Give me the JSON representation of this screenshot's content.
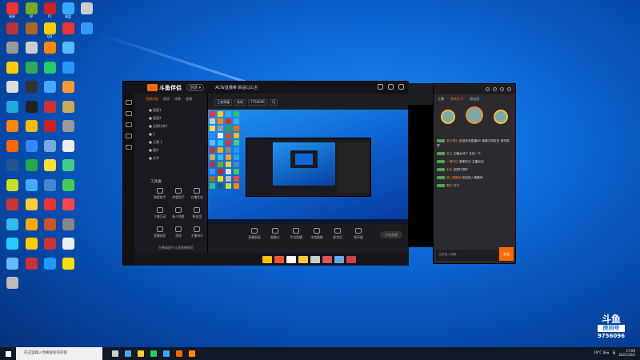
{
  "desktop": {
    "icons": [
      {
        "label": "网易",
        "color": "#e33"
      },
      {
        "label": "W",
        "color": "#7a2"
      },
      {
        "label": "F5",
        "color": "#c22"
      },
      {
        "label": "网盘",
        "color": "#3af"
      },
      {
        "label": "",
        "color": "#ccc"
      },
      {
        "label": "",
        "color": "#b33"
      },
      {
        "label": "",
        "color": "#a62"
      },
      {
        "label": "QQ",
        "color": "#fc0"
      },
      {
        "label": "",
        "color": "#e33"
      },
      {
        "label": "",
        "color": "#39f"
      },
      {
        "label": "",
        "color": "#999"
      },
      {
        "label": "",
        "color": "#ccc"
      },
      {
        "label": "",
        "color": "#f80"
      },
      {
        "label": "",
        "color": "#5bf"
      },
      {
        "label": "",
        "color": "#fc0"
      },
      {
        "label": "",
        "color": "#3a5"
      },
      {
        "label": "",
        "color": "#2c6"
      },
      {
        "label": "",
        "color": "#29f"
      },
      {
        "label": "",
        "color": "#ddd"
      },
      {
        "label": "",
        "color": "#333"
      },
      {
        "label": "",
        "color": "#4af"
      },
      {
        "label": "",
        "color": "#f93"
      },
      {
        "label": "",
        "color": "#2ad"
      },
      {
        "label": "",
        "color": "#222"
      },
      {
        "label": "",
        "color": "#c33"
      },
      {
        "label": "",
        "color": "#ca5"
      },
      {
        "label": "",
        "color": "#f80"
      },
      {
        "label": "",
        "color": "#fb0"
      },
      {
        "label": "",
        "color": "#c22"
      },
      {
        "label": "",
        "color": "#999"
      },
      {
        "label": "",
        "color": "#f60"
      },
      {
        "label": "",
        "color": "#38f"
      },
      {
        "label": "",
        "color": "#7ad"
      },
      {
        "label": "",
        "color": "#eee"
      },
      {
        "label": "",
        "color": "#258"
      },
      {
        "label": "",
        "color": "#2a4"
      },
      {
        "label": "",
        "color": "#fd3"
      },
      {
        "label": "",
        "color": "#4c8"
      },
      {
        "label": "",
        "color": "#cd2"
      },
      {
        "label": "",
        "color": "#4af"
      },
      {
        "label": "",
        "color": "#48c"
      },
      {
        "label": "",
        "color": "#4c5"
      },
      {
        "label": "",
        "color": "#c33"
      },
      {
        "label": "",
        "color": "#fc3"
      },
      {
        "label": "",
        "color": "#e33"
      },
      {
        "label": "",
        "color": "#f44"
      },
      {
        "label": "",
        "color": "#3be"
      },
      {
        "label": "",
        "color": "#fa0"
      },
      {
        "label": "",
        "color": "#c52"
      },
      {
        "label": "",
        "color": "#888"
      },
      {
        "label": "",
        "color": "#2cf"
      },
      {
        "label": "",
        "color": "#fc0"
      },
      {
        "label": "",
        "color": "#c33"
      },
      {
        "label": "",
        "color": "#eee"
      },
      {
        "label": "",
        "color": "#6bf"
      },
      {
        "label": "",
        "color": "#c33"
      },
      {
        "label": "",
        "color": "#29f"
      },
      {
        "label": "",
        "color": "#fd0"
      },
      {
        "label": "",
        "color": "#bbb"
      }
    ]
  },
  "app": {
    "logo": "斗鱼伴侣",
    "version": "创造 ▾",
    "stream_title": "ACW直播带 新品CJ公主",
    "tags": [
      "王者荣耀",
      "其他",
      "7756096",
      "CJ"
    ],
    "scene_tabs": [
      "直播内容",
      "画质",
      "场景",
      "直播"
    ],
    "scenes": [
      "■ 画面1",
      "■ 画面2",
      "■ 全屏拉伸1",
      "■ 1",
      "■ 元素 1",
      "■ 图片",
      "■ 文字"
    ],
    "tools_title": "工具箱",
    "tools": [
      "弹幕助手",
      "房管助手",
      "在播任务",
      "主播互动",
      "新人助推",
      "粉丝团",
      "直播抽奖",
      "游戏",
      "主播排行"
    ],
    "controls": [
      "直播画面",
      "摄像头",
      "手机直播",
      "本地摄像",
      "麦克风",
      "扬声器"
    ],
    "live_button": "开始直播",
    "notice": "主播请遵守斗鱼直播规范"
  },
  "chat": {
    "tabs": [
      "主播",
      "贵宾(17)",
      "粉丝团"
    ],
    "messages": [
      {
        "user": "官方提示",
        "text": "欢迎来到直播间! 弹幕文明发言 请勿刷屏"
      },
      {
        "user": "关注",
        "text": "主播太帅了 支持一下"
      },
      {
        "user": "一键关注",
        "text": "感谢关注 主播加油"
      },
      {
        "user": "水友",
        "text": "这把打得好"
      },
      {
        "user": "进入直播间",
        "text": "欢迎进入直播间"
      },
      {
        "user": "飘过",
        "text": "打卡"
      }
    ],
    "input_placeholder": "这里输入弹幕...",
    "send_label": "发送"
  },
  "watermark": {
    "logo": "斗鱼",
    "box": "房间号",
    "id": "9756096"
  },
  "taskbar": {
    "search_placeholder": "在这里输入你要搜索的内容",
    "weather": "16°C 多云",
    "lang": "英",
    "time": "17:00",
    "date": "2021/10/2"
  }
}
